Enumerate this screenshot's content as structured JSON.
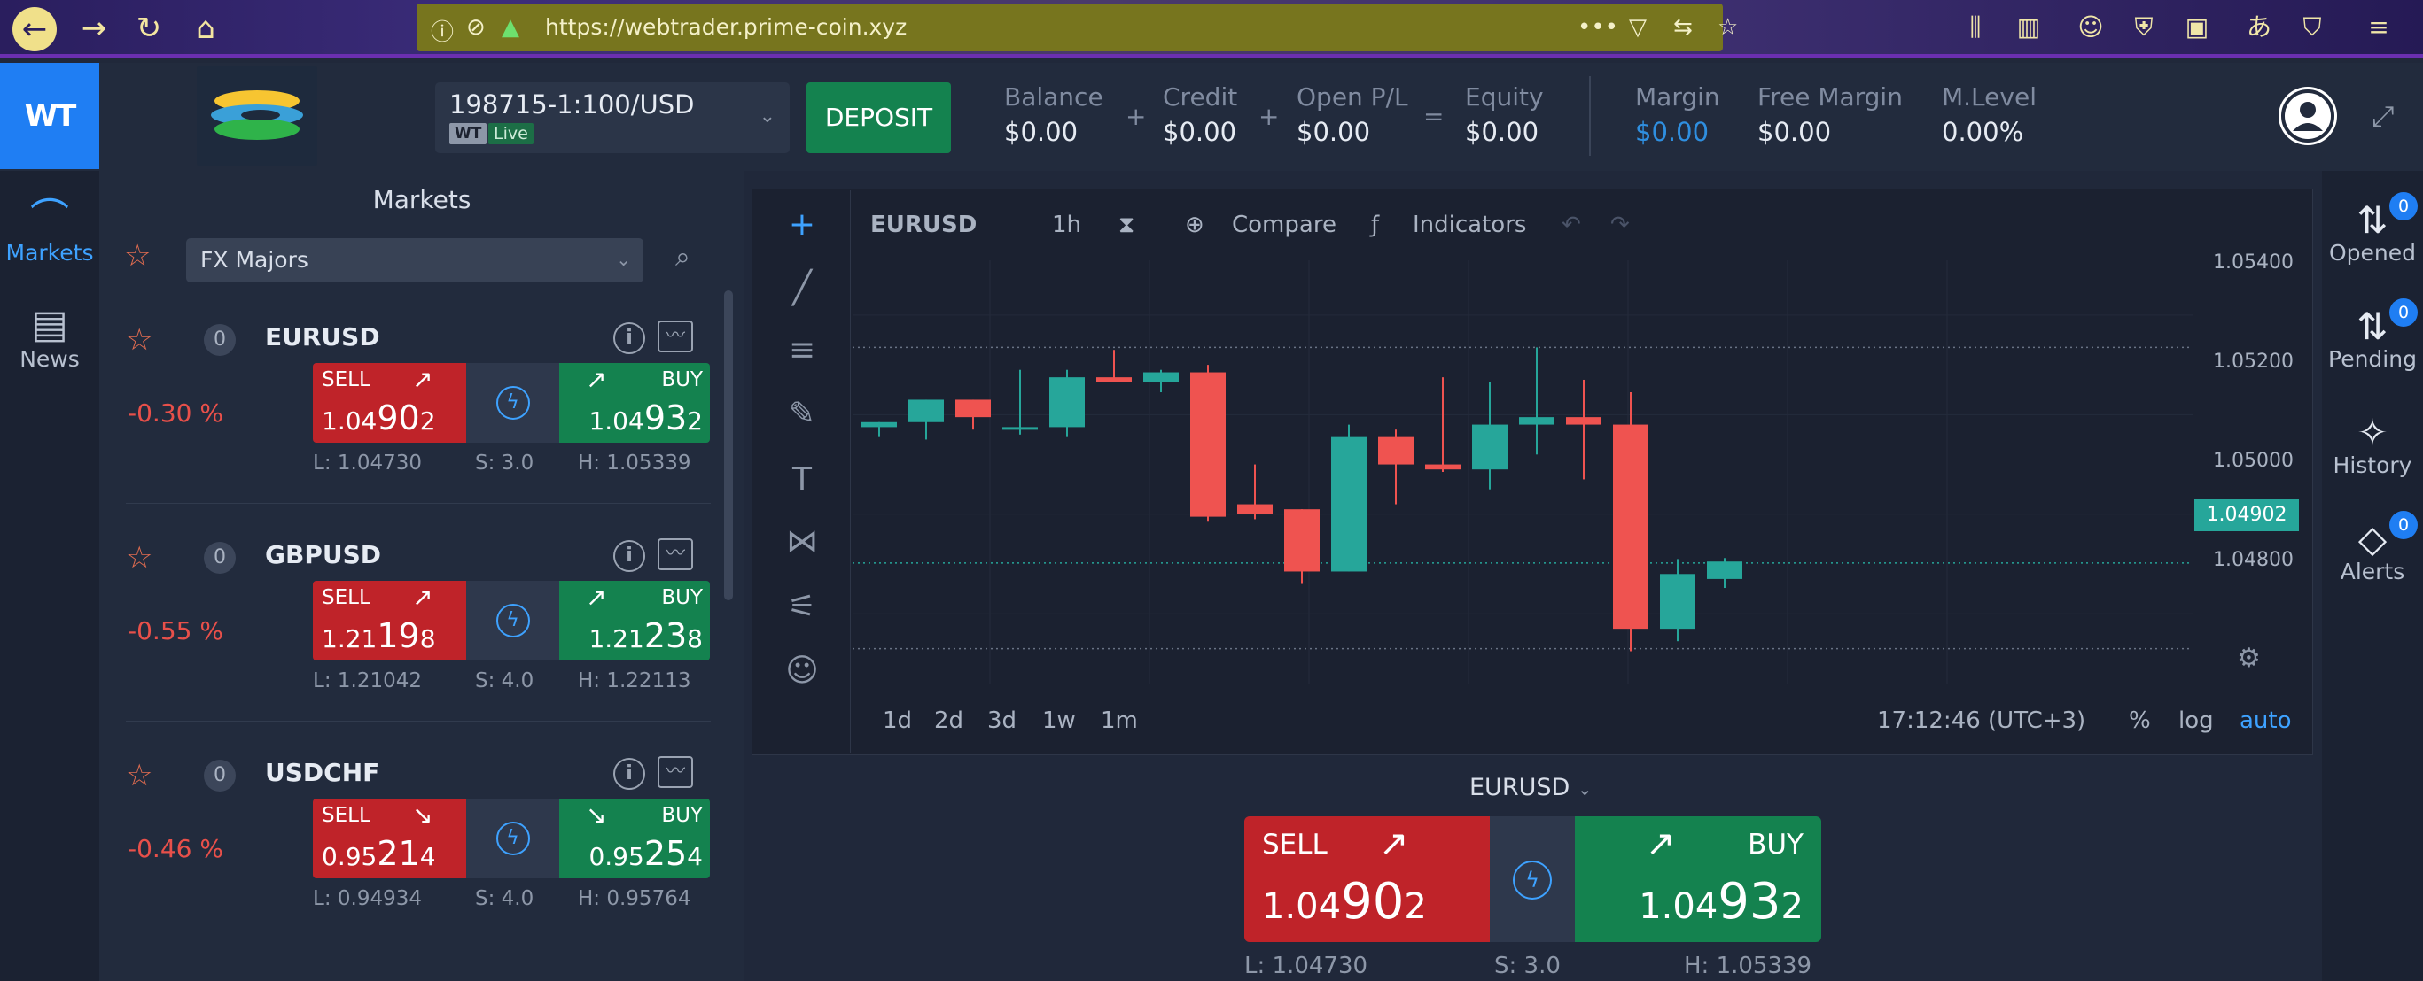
{
  "browser": {
    "url": "https://webtrader.prime-coin.xyz"
  },
  "header": {
    "logo_text": "WT",
    "account": {
      "number": "198715-1:100/USD",
      "tag": "WT",
      "mode": "Live"
    },
    "deposit_label": "DEPOSIT",
    "stats": [
      {
        "label": "Balance",
        "value": "$0.00"
      },
      {
        "label": "Credit",
        "value": "$0.00"
      },
      {
        "label": "Open P/L",
        "value": "$0.00"
      },
      {
        "label": "Equity",
        "value": "$0.00"
      },
      {
        "label": "Margin",
        "value": "$0.00"
      },
      {
        "label": "Free Margin",
        "value": "$0.00"
      },
      {
        "label": "M.Level",
        "value": "0.00%"
      }
    ],
    "operators": [
      "+",
      "+",
      "="
    ]
  },
  "leftnav": [
    {
      "label": "Markets",
      "icon": "markets-icon"
    },
    {
      "label": "News",
      "icon": "news-icon"
    }
  ],
  "markets": {
    "title": "Markets",
    "filter": "FX Majors",
    "rows": [
      {
        "symbol": "EURUSD",
        "count": "0",
        "change": "-0.30 %",
        "sell_label": "SELL",
        "buy_label": "BUY",
        "sell_pre": "1.04",
        "sell_big": "90",
        "sell_post": "2",
        "buy_pre": "1.04",
        "buy_big": "93",
        "buy_post": "2",
        "low": "L: 1.04730",
        "spread": "S: 3.0",
        "high": "H: 1.05339",
        "dir": "up"
      },
      {
        "symbol": "GBPUSD",
        "count": "0",
        "change": "-0.55 %",
        "sell_label": "SELL",
        "buy_label": "BUY",
        "sell_pre": "1.21",
        "sell_big": "19",
        "sell_post": "8",
        "buy_pre": "1.21",
        "buy_big": "23",
        "buy_post": "8",
        "low": "L: 1.21042",
        "spread": "S: 4.0",
        "high": "H: 1.22113",
        "dir": "up"
      },
      {
        "symbol": "USDCHF",
        "count": "0",
        "change": "-0.46 %",
        "sell_label": "SELL",
        "buy_label": "BUY",
        "sell_pre": "0.95",
        "sell_big": "21",
        "sell_post": "4",
        "buy_pre": "0.95",
        "buy_big": "25",
        "buy_post": "4",
        "low": "L: 0.94934",
        "spread": "S: 4.0",
        "high": "H: 0.95764",
        "dir": "down"
      }
    ]
  },
  "chart": {
    "symbol": "EURUSD",
    "interval": "1h",
    "compare_label": "Compare",
    "indicators_label": "Indicators",
    "ranges": [
      "1d",
      "2d",
      "3d",
      "1w",
      "1m"
    ],
    "time": "17:12:46 (UTC+3)",
    "scale_options": [
      "%",
      "log",
      "auto"
    ],
    "current_price": "1.04902",
    "y_labels": [
      "1.05400",
      "1.05200",
      "1.05000",
      "1.04800"
    ]
  },
  "chart_data": {
    "type": "candlestick",
    "ylim": [
      1.0466,
      1.0551
    ],
    "y_ticks": [
      1.054,
      1.052,
      1.05,
      1.048
    ],
    "candles": [
      {
        "o": 1.05175,
        "h": 1.05185,
        "l": 1.05155,
        "c": 1.05185
      },
      {
        "o": 1.05185,
        "h": 1.0523,
        "l": 1.0515,
        "c": 1.0523
      },
      {
        "o": 1.0523,
        "h": 1.0523,
        "l": 1.0517,
        "c": 1.05195
      },
      {
        "o": 1.05175,
        "h": 1.0529,
        "l": 1.0516,
        "c": 1.05175
      },
      {
        "o": 1.05175,
        "h": 1.0529,
        "l": 1.05155,
        "c": 1.05275
      },
      {
        "o": 1.05275,
        "h": 1.0533,
        "l": 1.0527,
        "c": 1.05265
      },
      {
        "o": 1.05265,
        "h": 1.0529,
        "l": 1.05245,
        "c": 1.05285
      },
      {
        "o": 1.05285,
        "h": 1.053,
        "l": 1.04985,
        "c": 1.04995
      },
      {
        "o": 1.0502,
        "h": 1.051,
        "l": 1.0499,
        "c": 1.05
      },
      {
        "o": 1.0501,
        "h": 1.0501,
        "l": 1.0486,
        "c": 1.04885
      },
      {
        "o": 1.04885,
        "h": 1.0518,
        "l": 1.04885,
        "c": 1.05155
      },
      {
        "o": 1.05155,
        "h": 1.0517,
        "l": 1.0502,
        "c": 1.051
      },
      {
        "o": 1.051,
        "h": 1.05275,
        "l": 1.05085,
        "c": 1.0509
      },
      {
        "o": 1.0509,
        "h": 1.05265,
        "l": 1.0505,
        "c": 1.0518
      },
      {
        "o": 1.0518,
        "h": 1.05335,
        "l": 1.0512,
        "c": 1.05195
      },
      {
        "o": 1.05195,
        "h": 1.0527,
        "l": 1.0507,
        "c": 1.0518
      },
      {
        "o": 1.0518,
        "h": 1.05245,
        "l": 1.04725,
        "c": 1.0477
      },
      {
        "o": 1.0477,
        "h": 1.0491,
        "l": 1.04745,
        "c": 1.0488
      },
      {
        "o": 1.0487,
        "h": 1.04912,
        "l": 1.04852,
        "c": 1.04905
      }
    ],
    "guides": [
      1.05335,
      1.04902,
      1.0473
    ]
  },
  "rightnav": [
    {
      "label": "Opened",
      "count": "0",
      "icon": "opened-icon"
    },
    {
      "label": "Pending",
      "count": "0",
      "icon": "pending-icon"
    },
    {
      "label": "History",
      "icon": "history-icon"
    },
    {
      "label": "Alerts",
      "count": "0",
      "icon": "alerts-icon"
    }
  ],
  "trade": {
    "symbol": "EURUSD",
    "sell_label": "SELL",
    "buy_label": "BUY",
    "sell_pre": "1.04",
    "sell_big": "90",
    "sell_post": "2",
    "buy_pre": "1.04",
    "buy_big": "93",
    "buy_post": "2",
    "low": "L: 1.04730",
    "spread": "S: 3.0",
    "high": "H: 1.05339"
  },
  "colors": {
    "up": "#26a69a",
    "down": "#ef5350",
    "accent": "#1f7ef3",
    "sell": "#bf2329",
    "buy": "#14824f"
  }
}
